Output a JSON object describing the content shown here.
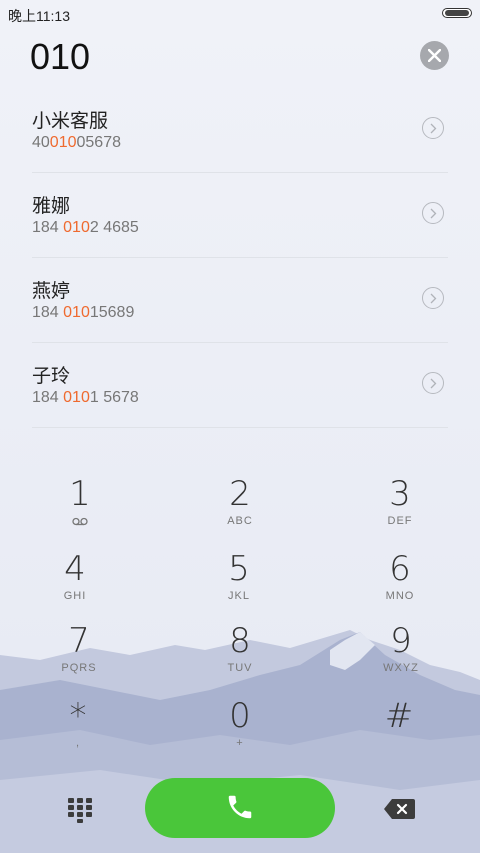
{
  "status": {
    "time": "晚上11:13"
  },
  "dialer": {
    "input": "010"
  },
  "results": [
    {
      "name": "小米客服",
      "pre": "40",
      "hl": "010",
      "post": "05678"
    },
    {
      "name": "雅娜",
      "pre": "184 ",
      "hl": "010",
      "post": "2 4685"
    },
    {
      "name": "燕婷",
      "pre": "184 ",
      "hl": "010",
      "post": "15689"
    },
    {
      "name": "子玲",
      "pre": "184 ",
      "hl": "010",
      "post": "1 5678"
    }
  ],
  "keys": [
    {
      "digit": "1",
      "letters": ""
    },
    {
      "digit": "2",
      "letters": "ABC"
    },
    {
      "digit": "3",
      "letters": "DEF"
    },
    {
      "digit": "4",
      "letters": "GHI"
    },
    {
      "digit": "5",
      "letters": "JKL"
    },
    {
      "digit": "6",
      "letters": "MNO"
    },
    {
      "digit": "7",
      "letters": "PQRS"
    },
    {
      "digit": "8",
      "letters": "TUV"
    },
    {
      "digit": "9",
      "letters": "WXYZ"
    },
    {
      "digit": "*",
      "letters": ","
    },
    {
      "digit": "0",
      "letters": "+"
    },
    {
      "digit": "#",
      "letters": ""
    }
  ],
  "icons": {
    "voicemail": "voicemail-icon",
    "dialpad": "dialpad-icon",
    "call": "phone-icon",
    "delete": "backspace-icon",
    "clear": "close-icon",
    "detail": "chevron-right-icon"
  },
  "colors": {
    "highlight": "#ef6a2f",
    "call": "#4ac63a"
  }
}
